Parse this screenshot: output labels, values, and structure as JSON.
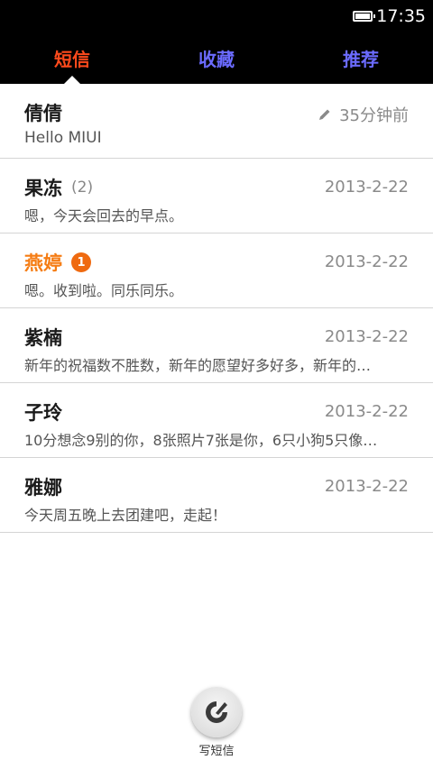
{
  "status": {
    "time": "17:35"
  },
  "tabs": [
    {
      "label": "短信",
      "color": "#ff4a1c",
      "active": true
    },
    {
      "label": "收藏",
      "color": "#6b6bff",
      "active": false
    },
    {
      "label": "推荐",
      "color": "#6b6bff",
      "active": false
    }
  ],
  "messages": [
    {
      "name": "倩倩",
      "count": "",
      "unread": "",
      "time": "35分钟前",
      "draft": true,
      "preview": "Hello MIUI",
      "name_color": "#1a1a1a"
    },
    {
      "name": "果冻",
      "count": "(2)",
      "unread": "",
      "time": "2013-2-22",
      "draft": false,
      "preview": "嗯，今天会回去的早点。",
      "name_color": "#1a1a1a"
    },
    {
      "name": "燕婷",
      "count": "",
      "unread": "1",
      "time": "2013-2-22",
      "draft": false,
      "preview": "嗯。收到啦。同乐同乐。",
      "name_color": "#f57c13"
    },
    {
      "name": "紫楠",
      "count": "",
      "unread": "",
      "time": "2013-2-22",
      "draft": false,
      "preview": "新年的祝福数不胜数，新年的愿望好多好多，新年的…",
      "name_color": "#1a1a1a"
    },
    {
      "name": "子玲",
      "count": "",
      "unread": "",
      "time": "2013-2-22",
      "draft": false,
      "preview": "10分想念9别的你，8张照片7张是你，6只小狗5只像…",
      "name_color": "#1a1a1a"
    },
    {
      "name": "雅娜",
      "count": "",
      "unread": "",
      "time": "2013-2-22",
      "draft": false,
      "preview": "今天周五晚上去团建吧，走起！",
      "name_color": "#1a1a1a"
    }
  ],
  "compose": {
    "label": "写短信",
    "icon": "compose-icon"
  },
  "colors": {
    "badge": "#ef6a10",
    "accent_tab": "#ff4a1c",
    "tab_inactive": "#6b6bff"
  }
}
